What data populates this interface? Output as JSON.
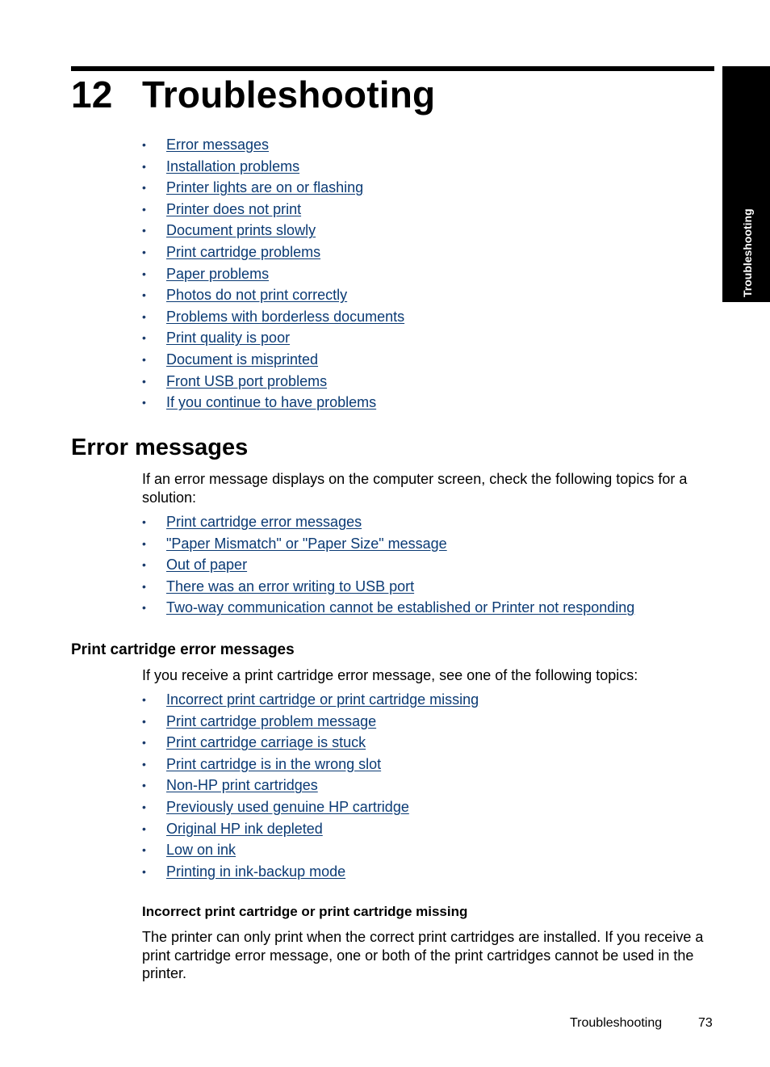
{
  "chapter": {
    "number": "12",
    "title": "Troubleshooting"
  },
  "side_tab": {
    "label": "Troubleshooting"
  },
  "colors": {
    "link": "#0a3a74",
    "text": "#000000",
    "tab_background": "#000000",
    "tab_text": "#ffffff"
  },
  "toc_links": [
    "Error messages",
    "Installation problems",
    "Printer lights are on or flashing",
    "Printer does not print",
    "Document prints slowly",
    "Print cartridge problems",
    "Paper problems",
    "Photos do not print correctly",
    "Problems with borderless documents",
    "Print quality is poor",
    "Document is misprinted",
    "Front USB port problems",
    "If you continue to have problems"
  ],
  "error_messages": {
    "heading": "Error messages",
    "intro": "If an error message displays on the computer screen, check the following topics for a solution:",
    "links": [
      "Print cartridge error messages",
      "\"Paper Mismatch\" or \"Paper Size\" message",
      "Out of paper",
      "There was an error writing to USB port",
      "Two-way communication cannot be established or Printer not responding"
    ]
  },
  "print_cartridge_errors": {
    "heading": "Print cartridge error messages",
    "intro": "If you receive a print cartridge error message, see one of the following topics:",
    "links": [
      "Incorrect print cartridge or print cartridge missing",
      "Print cartridge problem message",
      "Print cartridge carriage is stuck",
      "Print cartridge is in the wrong slot",
      "Non-HP print cartridges",
      "Previously used genuine HP cartridge",
      "Original HP ink depleted",
      "Low on ink",
      "Printing in ink-backup mode"
    ]
  },
  "incorrect_cartridge": {
    "heading": "Incorrect print cartridge or print cartridge missing",
    "body": "The printer can only print when the correct print cartridges are installed. If you receive a print cartridge error message, one or both of the print cartridges cannot be used in the printer."
  },
  "footer": {
    "section_label": "Troubleshooting",
    "page_number": "73"
  }
}
